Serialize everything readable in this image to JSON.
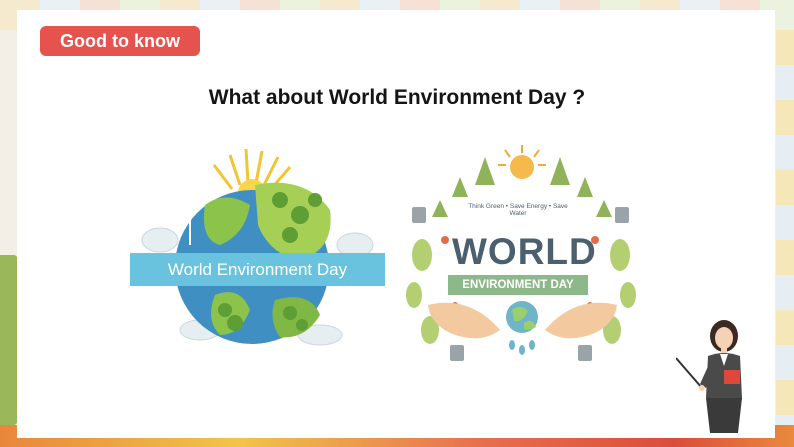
{
  "badge": {
    "label": "Good to know",
    "color": "#e6534e"
  },
  "heading": {
    "text": "What about World Environment Day ?"
  },
  "left_illustration": {
    "banner_text": "World Environment Day",
    "banner_color": "#69c3de"
  },
  "right_illustration": {
    "tagline": "Think Green • Save Energy • Save Water",
    "title": "WORLD",
    "subtitle": "ENVIRONMENT DAY",
    "ribbon_color": "#8db88a"
  },
  "icons": [
    "globe-icon",
    "sun-icon",
    "tree-icon",
    "hands-icon",
    "teacher-icon",
    "pointer-icon"
  ]
}
